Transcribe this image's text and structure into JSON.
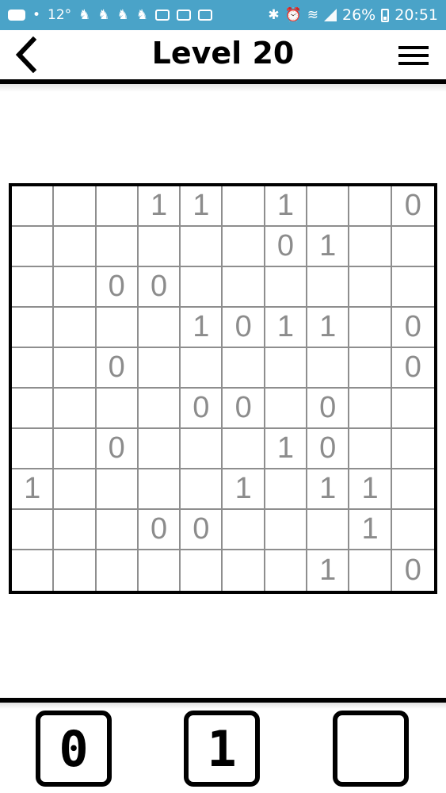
{
  "status_bar": {
    "temperature": "12°",
    "battery_percent": "26%",
    "time": "20:51"
  },
  "header": {
    "title": "Level 20"
  },
  "board": {
    "rows": [
      [
        "",
        "",
        "",
        "1",
        "1",
        "",
        "1",
        "",
        "",
        "0"
      ],
      [
        "",
        "",
        "",
        "",
        "",
        "",
        "0",
        "1",
        "",
        ""
      ],
      [
        "",
        "",
        "0",
        "0",
        "",
        "",
        "",
        "",
        "",
        ""
      ],
      [
        "",
        "",
        "",
        "",
        "1",
        "0",
        "1",
        "1",
        "",
        "0"
      ],
      [
        "",
        "",
        "0",
        "",
        "",
        "",
        "",
        "",
        "",
        "0"
      ],
      [
        "",
        "",
        "",
        "",
        "0",
        "0",
        "",
        "0",
        "",
        ""
      ],
      [
        "",
        "",
        "0",
        "",
        "",
        "",
        "1",
        "0",
        "",
        ""
      ],
      [
        "1",
        "",
        "",
        "",
        "",
        "1",
        "",
        "1",
        "1",
        ""
      ],
      [
        "",
        "",
        "",
        "0",
        "0",
        "",
        "",
        "",
        "1",
        ""
      ],
      [
        "",
        "",
        "",
        "",
        "",
        "",
        "",
        "1",
        "",
        "0"
      ]
    ]
  },
  "keys": [
    {
      "label": "0"
    },
    {
      "label": "1"
    },
    {
      "label": ""
    }
  ],
  "colors": {
    "status_bar": "#4aa3c8",
    "given_digit": "#8c8c8c",
    "grid_line": "#8e8e8e",
    "border": "#000000"
  }
}
